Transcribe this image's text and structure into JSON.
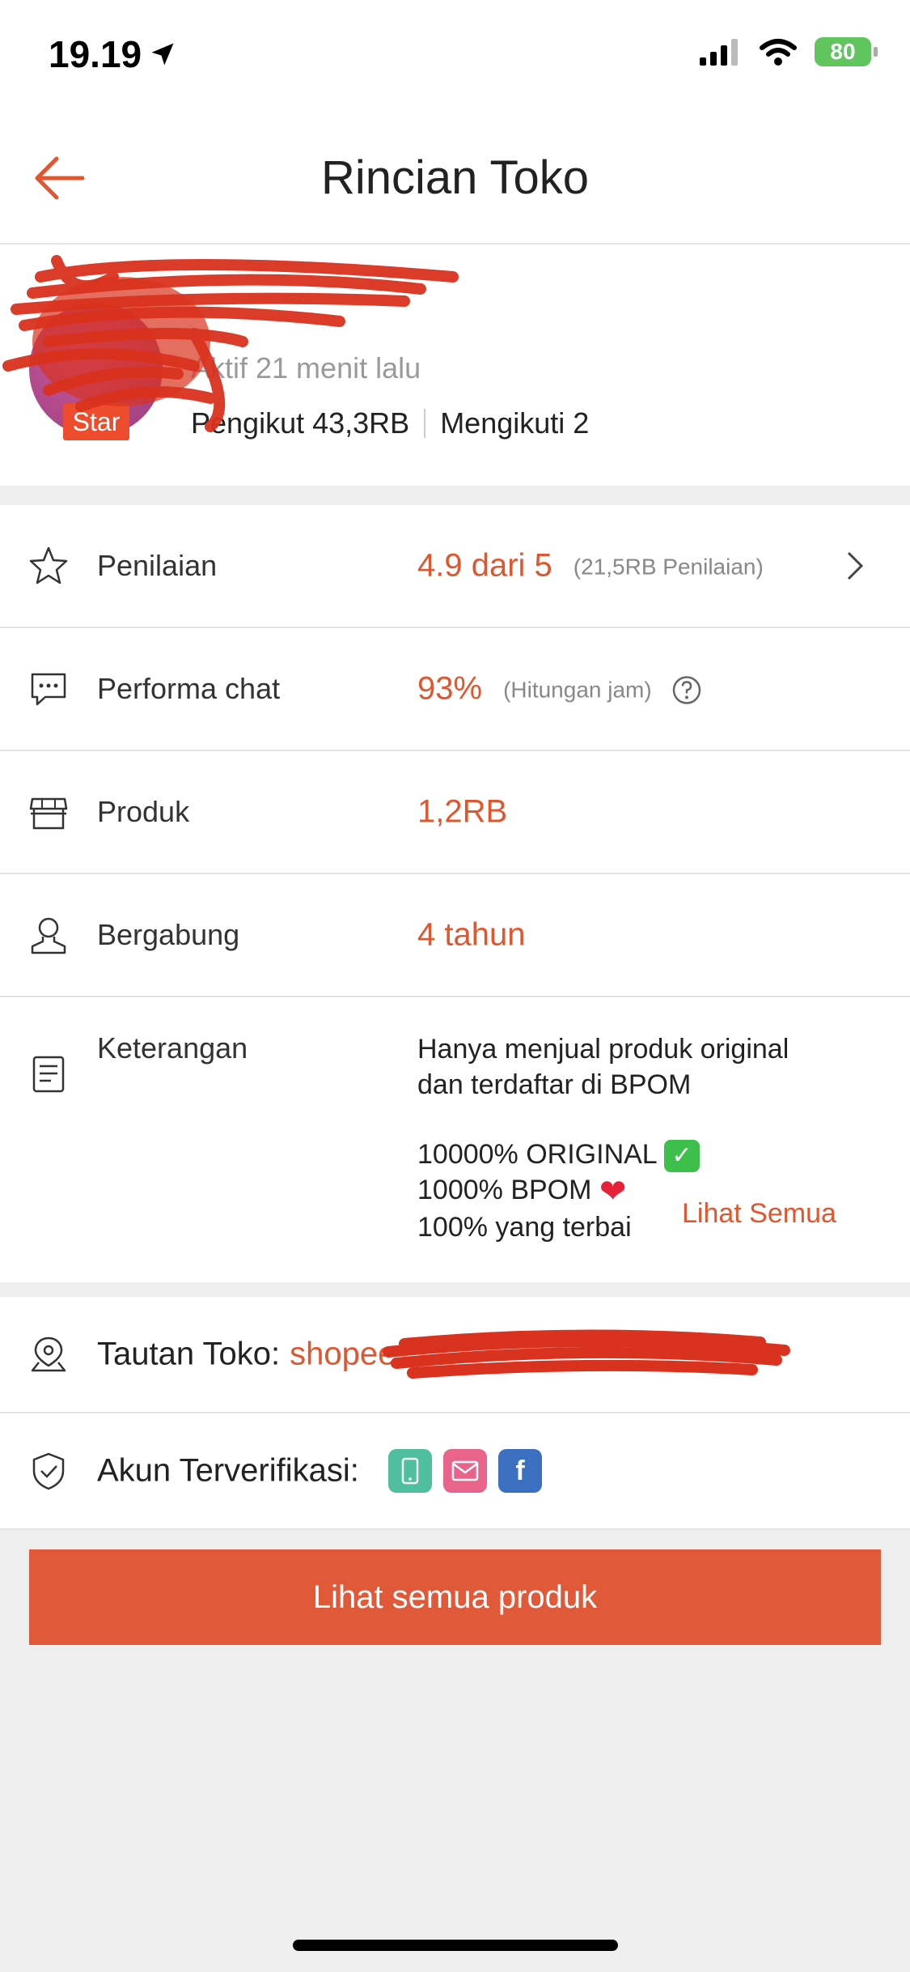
{
  "status_bar": {
    "time": "19.19",
    "battery": "80"
  },
  "header": {
    "title": "Rincian Toko"
  },
  "profile": {
    "active_status": "Aktif 21 menit lalu",
    "badge": "Star",
    "followers": "Pengikut 43,3RB",
    "following": "Mengikuti 2"
  },
  "stats": {
    "rating": {
      "label": "Penilaian",
      "value": "4.9 dari 5",
      "sub": "(21,5RB Penilaian)"
    },
    "chat": {
      "label": "Performa chat",
      "value": "93%",
      "sub": "(Hitungan jam)"
    },
    "products": {
      "label": "Produk",
      "value": "1,2RB"
    },
    "joined": {
      "label": "Bergabung",
      "value": "4 tahun"
    },
    "description": {
      "label": "Keterangan",
      "line1": "Hanya menjual produk original",
      "line2": "dan terdaftar di BPOM",
      "line3": "10000% ORIGINAL",
      "line4": "1000% BPOM",
      "line5": "100% yang terbai",
      "see_all": "Lihat Semua"
    }
  },
  "links": {
    "shop_link_label": "Tautan Toko:",
    "shop_link_value": "shopee",
    "verified_label": "Akun Terverifikasi:"
  },
  "cta": {
    "label": "Lihat semua produk"
  },
  "icons": [
    "back-arrow-icon",
    "star-icon",
    "chat-icon",
    "store-icon",
    "person-icon",
    "document-icon",
    "location-icon",
    "shield-check-icon",
    "chevron-right-icon",
    "help-icon",
    "phone-icon",
    "mail-icon",
    "facebook-icon"
  ],
  "colors": {
    "accent": "#e0572f",
    "button": "#e05a3a",
    "badge": "#ee4d2d"
  }
}
